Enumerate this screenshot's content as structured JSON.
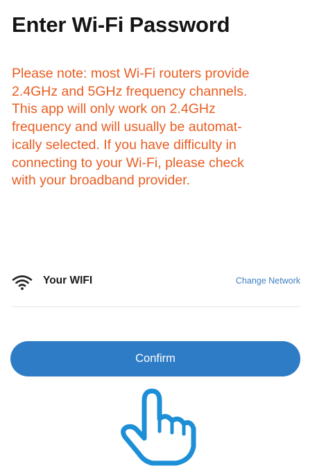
{
  "header": {
    "title": "Enter Wi-Fi Password"
  },
  "notice": {
    "lines": [
      "Please note: most Wi-Fi routers provide",
      "2.4GHz and 5GHz frequency channels.",
      "This app will only work on 2.4GHz",
      "frequency and will usually be automat-",
      "ically selected. If you have difficulty in",
      "connecting to your Wi-Fi, please check",
      "with your broadband provider."
    ],
    "color": "#e85d22"
  },
  "network": {
    "icon": "wifi-icon",
    "name": "Your WIFI",
    "change_label": "Change Network"
  },
  "actions": {
    "confirm_label": "Confirm",
    "accent_color": "#2f7cc6"
  },
  "overlay": {
    "icon": "pointing-hand-icon",
    "color": "#1d8fd6"
  }
}
